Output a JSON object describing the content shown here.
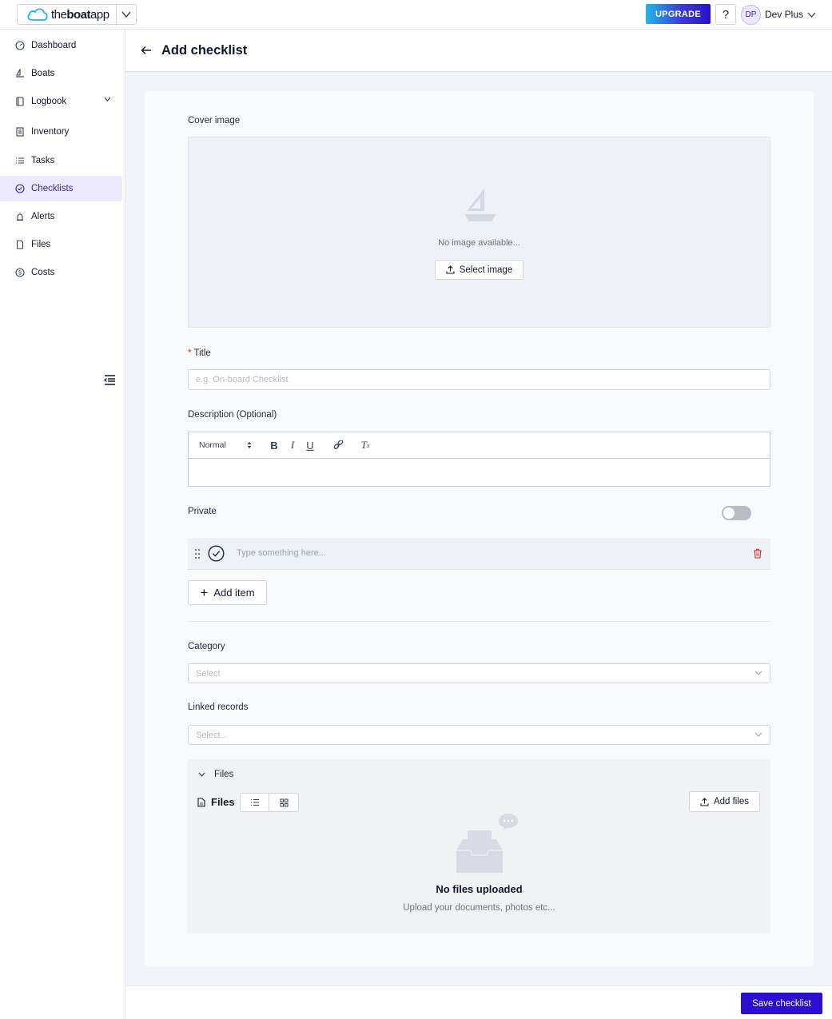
{
  "app": {
    "brand_prefix": "the",
    "brand_bold": "boat",
    "brand_suffix": "app"
  },
  "header": {
    "upgrade_label": "UPGRADE",
    "help_label": "?",
    "user_initials": "DP",
    "user_name": "Dev Plus"
  },
  "sidebar": {
    "items": [
      {
        "label": "Dashboard",
        "icon": "dashboard-icon"
      },
      {
        "label": "Boats",
        "icon": "boat-icon"
      },
      {
        "label": "Logbook",
        "icon": "book-icon"
      },
      {
        "label": "Inventory",
        "icon": "inventory-icon"
      },
      {
        "label": "Tasks",
        "icon": "list-icon"
      },
      {
        "label": "Checklists",
        "icon": "check-circle-icon",
        "active": true
      },
      {
        "label": "Alerts",
        "icon": "alarm-icon"
      },
      {
        "label": "Files",
        "icon": "file-icon"
      },
      {
        "label": "Costs",
        "icon": "dollar-icon"
      }
    ]
  },
  "page": {
    "title": "Add checklist"
  },
  "form": {
    "cover_label": "Cover image",
    "cover_empty": "No image available...",
    "select_image": "Select image",
    "title_required": "*",
    "title_label": "Title",
    "title_placeholder": "e.g. On-board Checklist",
    "description_label": "Description (Optional)",
    "editor_format": "Normal",
    "private_label": "Private",
    "private_on": false,
    "item_placeholder": "Type something here...",
    "add_item": "Add item",
    "category_label": "Category",
    "category_placeholder": "Select",
    "linked_label": "Linked records",
    "linked_placeholder": "Select..."
  },
  "files": {
    "section_label": "Files",
    "title": "Files",
    "add_files": "Add files",
    "empty_title": "No files uploaded",
    "empty_sub": "Upload your documents, photos etc..."
  },
  "footer": {
    "save_label": "Save checklist"
  },
  "colors": {
    "accent": "#2a0fd1",
    "active_bg": "#ede9fe",
    "danger": "#dc2626"
  }
}
